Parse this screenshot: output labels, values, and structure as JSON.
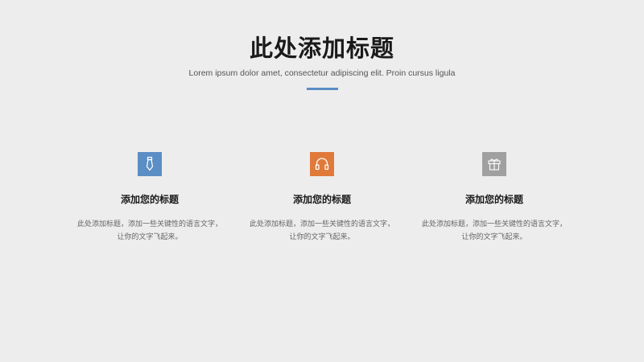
{
  "header": {
    "title": "此处添加标题",
    "subtitle": "Lorem ipsum dolor amet, consectetur adipiscing elit. Proin cursus ligula"
  },
  "colors": {
    "background": "#ededed",
    "divider": "#5b8ec4",
    "blue": "#5b8ec4",
    "orange": "#e07a3a",
    "gray": "#a0a0a0"
  },
  "features": [
    {
      "icon": "necktie-icon",
      "title": "添加您的标题",
      "desc_line1": "此处添加标题，添加一些关键性的语言文字，",
      "desc_line2": "让你的文字飞起来。"
    },
    {
      "icon": "headphones-icon",
      "title": "添加您的标题",
      "desc_line1": "此处添加标题，添加一些关键性的语言文字，",
      "desc_line2": "让你的文字飞起来。"
    },
    {
      "icon": "gift-box-icon",
      "title": "添加您的标题",
      "desc_line1": "此处添加标题，添加一些关键性的语言文字，",
      "desc_line2": "让你的文字飞起来。"
    }
  ]
}
